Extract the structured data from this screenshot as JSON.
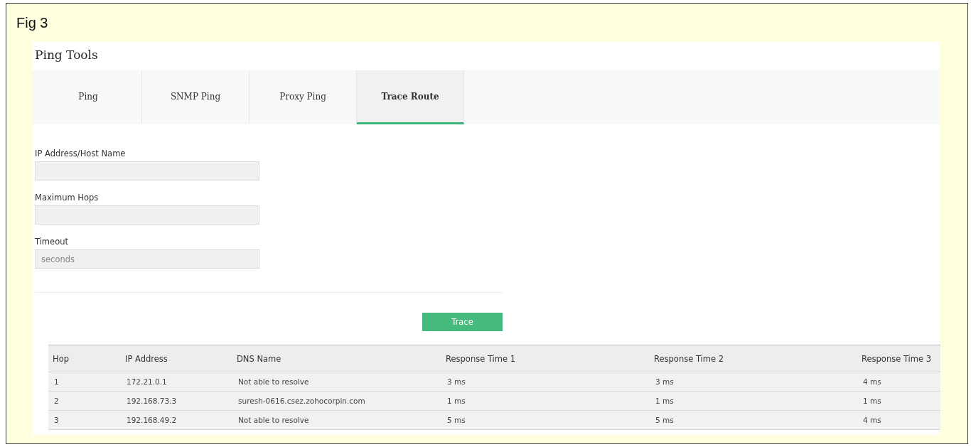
{
  "figure_label": "Fig 3",
  "title": "Ping Tools",
  "tabs": [
    {
      "label": "Ping",
      "selected": false
    },
    {
      "label": "SNMP Ping",
      "selected": false
    },
    {
      "label": "Proxy Ping",
      "selected": false
    },
    {
      "label": "Trace Route",
      "selected": true
    }
  ],
  "form": {
    "fields": [
      {
        "label": "IP Address/Host Name"
      },
      {
        "label": "Maximum Hops"
      },
      {
        "label": "Timeout",
        "placeholder": "seconds"
      }
    ]
  },
  "trace_button": "Trace",
  "table": {
    "columns": [
      "Hop",
      "IP Address",
      "DNS Name",
      "Response Time 1",
      "Response Time 2",
      "Response Time 3"
    ],
    "rows": [
      [
        "1",
        "172.21.0.1",
        "Not able to resolve",
        "3 ms",
        "3 ms",
        "4 ms"
      ],
      [
        "2",
        "192.168.73.3",
        "suresh-0616.csez.zohocorpin.com",
        "1 ms",
        "1 ms",
        "1 ms"
      ],
      [
        "3",
        "192.168.49.2",
        "Not able to resolve",
        "5 ms",
        "5 ms",
        "4 ms"
      ]
    ]
  }
}
